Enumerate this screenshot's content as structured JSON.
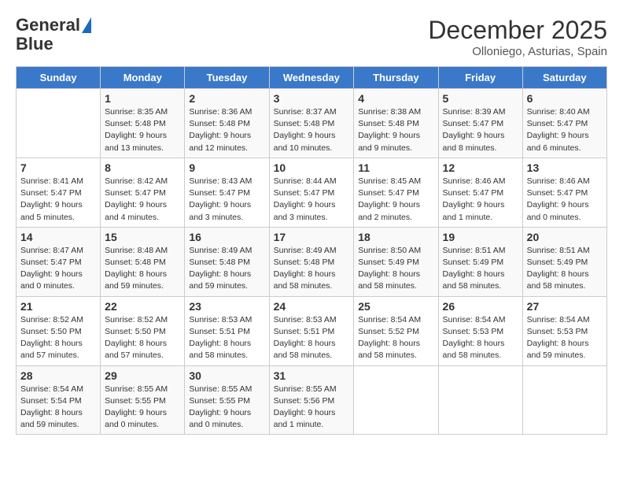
{
  "logo": {
    "line1": "General",
    "line2": "Blue"
  },
  "title": "December 2025",
  "subtitle": "Olloniego, Asturias, Spain",
  "days_of_week": [
    "Sunday",
    "Monday",
    "Tuesday",
    "Wednesday",
    "Thursday",
    "Friday",
    "Saturday"
  ],
  "weeks": [
    [
      {
        "day": "",
        "info": ""
      },
      {
        "day": "1",
        "info": "Sunrise: 8:35 AM\nSunset: 5:48 PM\nDaylight: 9 hours\nand 13 minutes."
      },
      {
        "day": "2",
        "info": "Sunrise: 8:36 AM\nSunset: 5:48 PM\nDaylight: 9 hours\nand 12 minutes."
      },
      {
        "day": "3",
        "info": "Sunrise: 8:37 AM\nSunset: 5:48 PM\nDaylight: 9 hours\nand 10 minutes."
      },
      {
        "day": "4",
        "info": "Sunrise: 8:38 AM\nSunset: 5:48 PM\nDaylight: 9 hours\nand 9 minutes."
      },
      {
        "day": "5",
        "info": "Sunrise: 8:39 AM\nSunset: 5:47 PM\nDaylight: 9 hours\nand 8 minutes."
      },
      {
        "day": "6",
        "info": "Sunrise: 8:40 AM\nSunset: 5:47 PM\nDaylight: 9 hours\nand 6 minutes."
      }
    ],
    [
      {
        "day": "7",
        "info": "Sunrise: 8:41 AM\nSunset: 5:47 PM\nDaylight: 9 hours\nand 5 minutes."
      },
      {
        "day": "8",
        "info": "Sunrise: 8:42 AM\nSunset: 5:47 PM\nDaylight: 9 hours\nand 4 minutes."
      },
      {
        "day": "9",
        "info": "Sunrise: 8:43 AM\nSunset: 5:47 PM\nDaylight: 9 hours\nand 3 minutes."
      },
      {
        "day": "10",
        "info": "Sunrise: 8:44 AM\nSunset: 5:47 PM\nDaylight: 9 hours\nand 3 minutes."
      },
      {
        "day": "11",
        "info": "Sunrise: 8:45 AM\nSunset: 5:47 PM\nDaylight: 9 hours\nand 2 minutes."
      },
      {
        "day": "12",
        "info": "Sunrise: 8:46 AM\nSunset: 5:47 PM\nDaylight: 9 hours\nand 1 minute."
      },
      {
        "day": "13",
        "info": "Sunrise: 8:46 AM\nSunset: 5:47 PM\nDaylight: 9 hours\nand 0 minutes."
      }
    ],
    [
      {
        "day": "14",
        "info": "Sunrise: 8:47 AM\nSunset: 5:47 PM\nDaylight: 9 hours\nand 0 minutes."
      },
      {
        "day": "15",
        "info": "Sunrise: 8:48 AM\nSunset: 5:48 PM\nDaylight: 8 hours\nand 59 minutes."
      },
      {
        "day": "16",
        "info": "Sunrise: 8:49 AM\nSunset: 5:48 PM\nDaylight: 8 hours\nand 59 minutes."
      },
      {
        "day": "17",
        "info": "Sunrise: 8:49 AM\nSunset: 5:48 PM\nDaylight: 8 hours\nand 58 minutes."
      },
      {
        "day": "18",
        "info": "Sunrise: 8:50 AM\nSunset: 5:49 PM\nDaylight: 8 hours\nand 58 minutes."
      },
      {
        "day": "19",
        "info": "Sunrise: 8:51 AM\nSunset: 5:49 PM\nDaylight: 8 hours\nand 58 minutes."
      },
      {
        "day": "20",
        "info": "Sunrise: 8:51 AM\nSunset: 5:49 PM\nDaylight: 8 hours\nand 58 minutes."
      }
    ],
    [
      {
        "day": "21",
        "info": "Sunrise: 8:52 AM\nSunset: 5:50 PM\nDaylight: 8 hours\nand 57 minutes."
      },
      {
        "day": "22",
        "info": "Sunrise: 8:52 AM\nSunset: 5:50 PM\nDaylight: 8 hours\nand 57 minutes."
      },
      {
        "day": "23",
        "info": "Sunrise: 8:53 AM\nSunset: 5:51 PM\nDaylight: 8 hours\nand 58 minutes."
      },
      {
        "day": "24",
        "info": "Sunrise: 8:53 AM\nSunset: 5:51 PM\nDaylight: 8 hours\nand 58 minutes."
      },
      {
        "day": "25",
        "info": "Sunrise: 8:54 AM\nSunset: 5:52 PM\nDaylight: 8 hours\nand 58 minutes."
      },
      {
        "day": "26",
        "info": "Sunrise: 8:54 AM\nSunset: 5:53 PM\nDaylight: 8 hours\nand 58 minutes."
      },
      {
        "day": "27",
        "info": "Sunrise: 8:54 AM\nSunset: 5:53 PM\nDaylight: 8 hours\nand 59 minutes."
      }
    ],
    [
      {
        "day": "28",
        "info": "Sunrise: 8:54 AM\nSunset: 5:54 PM\nDaylight: 8 hours\nand 59 minutes."
      },
      {
        "day": "29",
        "info": "Sunrise: 8:55 AM\nSunset: 5:55 PM\nDaylight: 9 hours\nand 0 minutes."
      },
      {
        "day": "30",
        "info": "Sunrise: 8:55 AM\nSunset: 5:55 PM\nDaylight: 9 hours\nand 0 minutes."
      },
      {
        "day": "31",
        "info": "Sunrise: 8:55 AM\nSunset: 5:56 PM\nDaylight: 9 hours\nand 1 minute."
      },
      {
        "day": "",
        "info": ""
      },
      {
        "day": "",
        "info": ""
      },
      {
        "day": "",
        "info": ""
      }
    ]
  ]
}
